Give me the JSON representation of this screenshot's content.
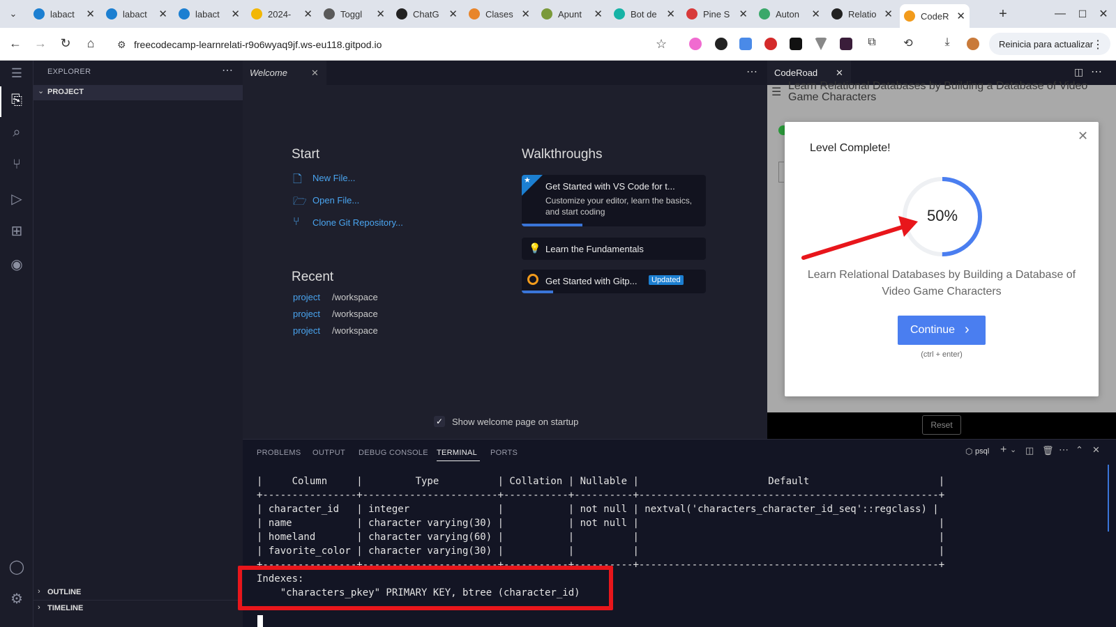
{
  "browser": {
    "tabs": [
      {
        "label": "labact",
        "icon": "gitpod-icon",
        "color": "#1c7fd1"
      },
      {
        "label": "labact",
        "icon": "gitpod-icon",
        "color": "#1c7fd1"
      },
      {
        "label": "labact",
        "icon": "gitpod-icon",
        "color": "#1c7fd1"
      },
      {
        "label": "2024-",
        "icon": "drive-icon",
        "color": "#f2b705"
      },
      {
        "label": "Toggl",
        "icon": "toggl-icon",
        "color": "#5a5a5a"
      },
      {
        "label": "ChatG",
        "icon": "chatgpt-icon",
        "color": "#222222"
      },
      {
        "label": "Clases",
        "icon": "clases-icon",
        "color": "#e8852a"
      },
      {
        "label": "Apunt",
        "icon": "apuntes-icon",
        "color": "#7a9a3a"
      },
      {
        "label": "Bot de",
        "icon": "bot-icon",
        "color": "#16b3a6"
      },
      {
        "label": "Pine S",
        "icon": "pine-icon",
        "color": "#d83a3a"
      },
      {
        "label": "Auton",
        "icon": "auton-icon",
        "color": "#3aa86a"
      },
      {
        "label": "Relatio",
        "icon": "relation-icon",
        "color": "#222222"
      },
      {
        "label": "CodeR",
        "icon": "coderoad-icon",
        "color": "#f29b1c",
        "active": true
      }
    ],
    "new_tab": "+",
    "url": "freecodecamp-learnrelati-r9o6wyaq9jf.ws-eu118.gitpod.io",
    "update_button": "Reinicia para actualizar"
  },
  "vscode": {
    "explorer_title": "EXPLORER",
    "project_label": "PROJECT",
    "outline_label": "OUTLINE",
    "timeline_label": "TIMELINE",
    "welcome_tab": "Welcome",
    "start_heading": "Start",
    "start_links": [
      "New File...",
      "Open File...",
      "Clone Git Repository..."
    ],
    "recent_heading": "Recent",
    "recent_items": [
      {
        "name": "project",
        "path": "/workspace"
      },
      {
        "name": "project",
        "path": "/workspace"
      },
      {
        "name": "project",
        "path": "/workspace"
      }
    ],
    "walkthroughs_heading": "Walkthroughs",
    "walkthrough_1_title": "Get Started with VS Code for t...",
    "walkthrough_1_desc": "Customize your editor, learn the basics, and start coding",
    "walkthrough_1_progress": 0.33,
    "walkthrough_2_title": "Learn the Fundamentals",
    "walkthrough_3_title": "Get Started with Gitp...",
    "walkthrough_3_badge": "Updated",
    "walkthrough_3_progress": 0.17,
    "show_welcome": "Show welcome page on startup"
  },
  "coderoad": {
    "tab_label": "CodeRoad",
    "header_title": "Learn Relational Databases by Building a Database of Video Game Characters",
    "modal_title": "Level Complete!",
    "progress_percent": 50,
    "progress_label": "50%",
    "tutorial_title": "Learn Relational Databases by Building a Database of Video Game Characters",
    "continue_label": "Continue",
    "shortcut": "(ctrl + enter)",
    "reset_label": "Reset"
  },
  "panel": {
    "tabs": [
      "PROBLEMS",
      "OUTPUT",
      "DEBUG CONSOLE",
      "TERMINAL",
      "PORTS"
    ],
    "active_tab": "TERMINAL",
    "shell_label": "psql",
    "terminal_lines": [
      "|     Column     |         Type          | Collation | Nullable |                      Default                      |",
      "+----------------+-----------------------+-----------+----------+---------------------------------------------------+",
      "| character_id   | integer               |           | not null | nextval('characters_character_id_seq'::regclass) |",
      "| name           | character varying(30) |           | not null |                                                   |",
      "| homeland       | character varying(60) |           |          |                                                   |",
      "| favorite_color | character varying(30) |           |          |                                                   |",
      "+----------------+-----------------------+-----------+----------+---------------------------------------------------+",
      "Indexes:",
      "    \"characters_pkey\" PRIMARY KEY, btree (character_id)"
    ]
  },
  "colors": {
    "accent": "#4a7ef0",
    "annotation_red": "#e8161b"
  }
}
